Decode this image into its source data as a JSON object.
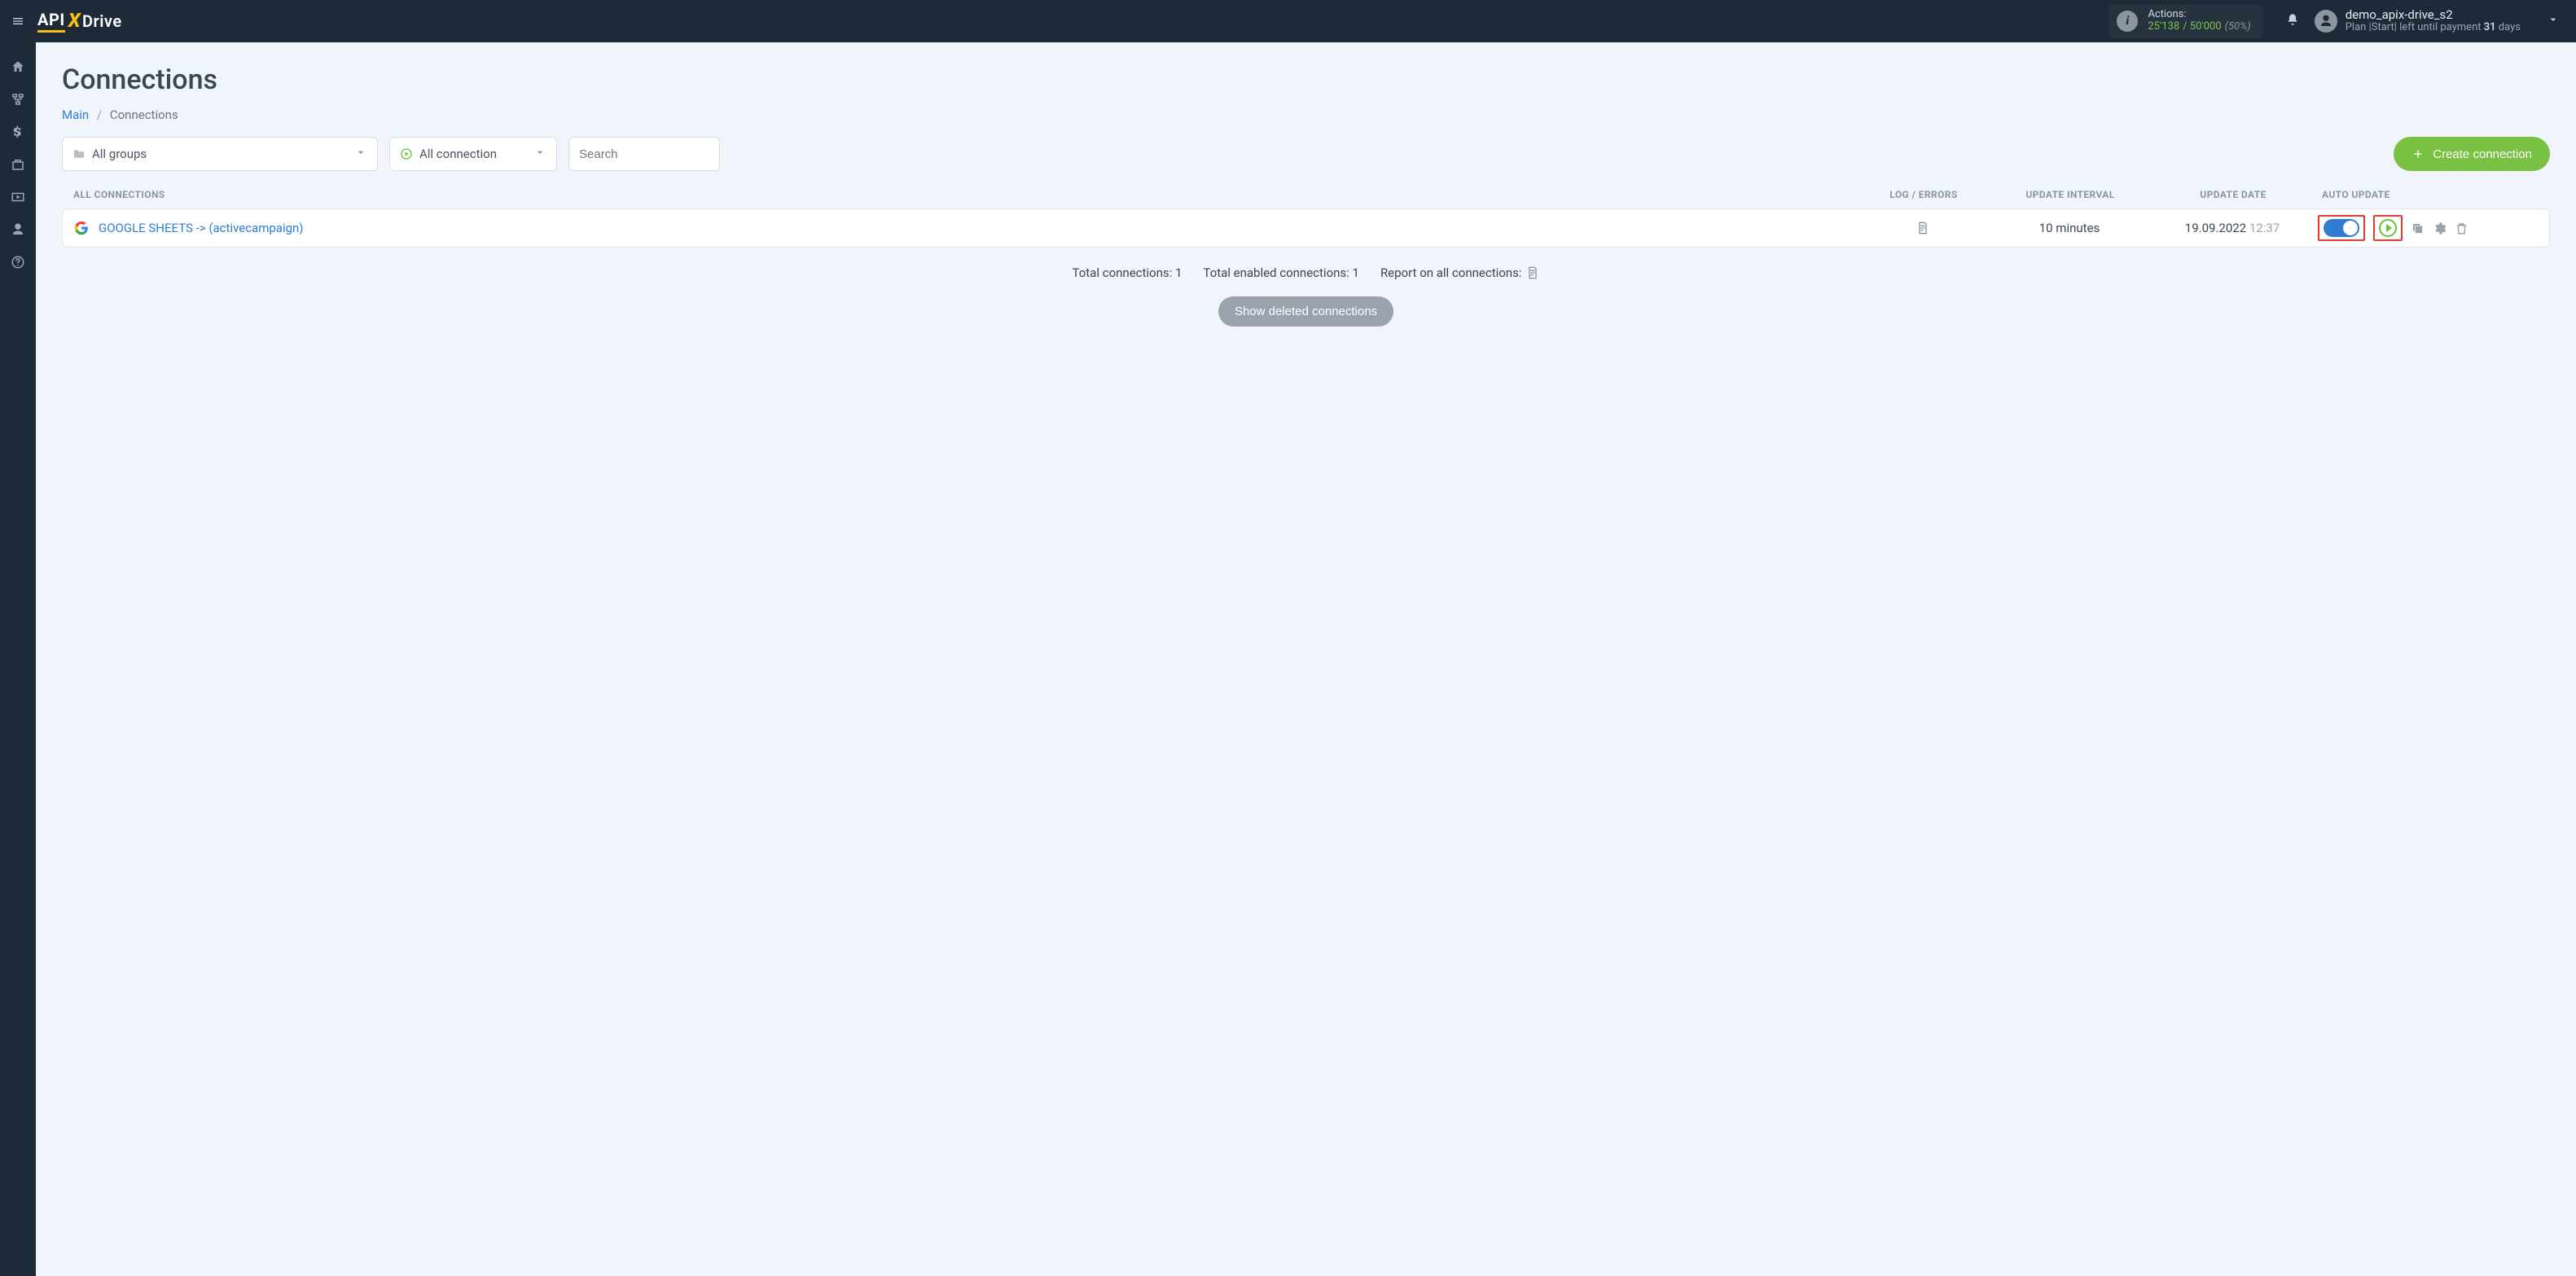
{
  "brand": {
    "part1": "API",
    "part2": "X",
    "part3": "Drive"
  },
  "actions_box": {
    "label": "Actions:",
    "used": "25'138",
    "separator": "/",
    "total": "50'000",
    "percent": "(50%)"
  },
  "user": {
    "name": "demo_apix-drive_s2",
    "plan_prefix": "Plan |",
    "plan_name": "Start",
    "plan_mid": "| left until payment ",
    "days_num": "31",
    "days_word": " days"
  },
  "sidebar_icons": [
    "home",
    "sitemap",
    "dollar",
    "briefcase",
    "youtube",
    "user",
    "help"
  ],
  "page": {
    "title": "Connections",
    "breadcrumb_main": "Main",
    "breadcrumb_current": "Connections"
  },
  "filters": {
    "groups_label": "All groups",
    "status_label": "All connection",
    "search_placeholder": "Search",
    "create_label": "Create connection"
  },
  "table_head": {
    "name": "ALL CONNECTIONS",
    "log": "LOG / ERRORS",
    "interval": "UPDATE INTERVAL",
    "date": "UPDATE DATE",
    "auto": "AUTO UPDATE"
  },
  "row": {
    "name": "GOOGLE SHEETS -> (activecampaign)",
    "interval": "10 minutes",
    "date": "19.09.2022",
    "time": "12:37"
  },
  "summary": {
    "total": "Total connections: 1",
    "enabled": "Total enabled connections: 1",
    "report": "Report on all connections:"
  },
  "deleted_btn": "Show deleted connections"
}
